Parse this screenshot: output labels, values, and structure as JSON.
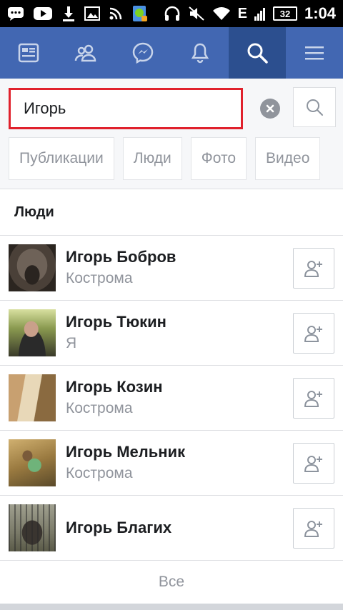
{
  "status_bar": {
    "battery": "32",
    "network": "E",
    "time": "1:04",
    "icons": [
      "messages-icon",
      "youtube-icon",
      "download-icon",
      "gallery-icon",
      "rss-icon",
      "app-icon",
      "headphones-icon",
      "mute-icon",
      "wifi-icon",
      "signal-icon",
      "battery-icon"
    ]
  },
  "nav": {
    "items": [
      "news-feed-icon",
      "friends-icon",
      "messenger-icon",
      "notifications-icon",
      "search-icon",
      "menu-icon"
    ],
    "active": "search-icon"
  },
  "search": {
    "value": "Игорь",
    "filters": [
      "Публикации",
      "Люди",
      "Фото",
      "Видео"
    ]
  },
  "people": {
    "title": "Люди",
    "items": [
      {
        "name": "Игорь Бобров",
        "subtitle": "Кострома"
      },
      {
        "name": "Игорь Тюкин",
        "subtitle": "Я"
      },
      {
        "name": "Игорь Козин",
        "subtitle": "Кострома"
      },
      {
        "name": "Игорь Мельник",
        "subtitle": "Кострома"
      },
      {
        "name": "Игорь Благих",
        "subtitle": ""
      }
    ],
    "see_all": "Все"
  },
  "colors": {
    "nav_bg": "#4267b2",
    "nav_active": "#2c4f8f",
    "search_border": "#e0212c",
    "muted_text": "#90949c"
  }
}
